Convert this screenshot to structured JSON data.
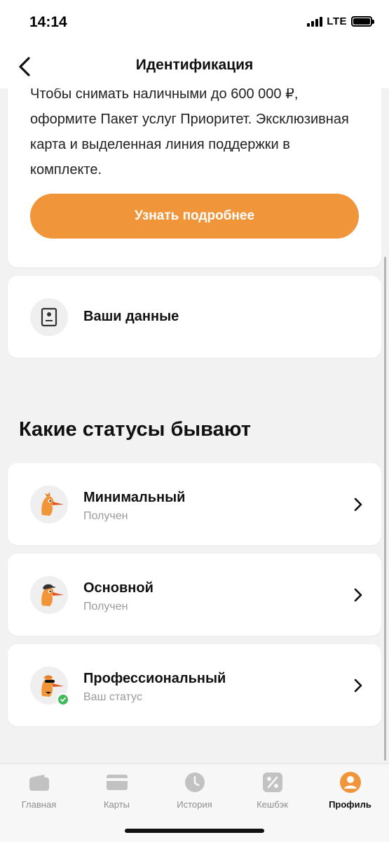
{
  "status_bar": {
    "time": "14:14",
    "network": "LTE"
  },
  "header": {
    "title": "Идентификация"
  },
  "promo": {
    "text": "Чтобы снимать наличными до 600 000 ₽, оформите Пакет услуг Приоритет. Эксклюзивная карта и выделенная линия поддержки в комплекте.",
    "button_label": "Узнать подробнее"
  },
  "your_data": {
    "label": "Ваши данные"
  },
  "statuses": {
    "title": "Какие статусы бывают",
    "items": [
      {
        "title": "Минимальный",
        "subtitle": "Получен"
      },
      {
        "title": "Основной",
        "subtitle": "Получен"
      },
      {
        "title": "Профессиональный",
        "subtitle": "Ваш статус"
      }
    ]
  },
  "tabs": [
    {
      "label": "Главная",
      "icon": "wallet-icon",
      "active": false
    },
    {
      "label": "Карты",
      "icon": "card-icon",
      "active": false
    },
    {
      "label": "История",
      "icon": "clock-icon",
      "active": false
    },
    {
      "label": "Кешбэк",
      "icon": "percent-icon",
      "active": false
    },
    {
      "label": "Профиль",
      "icon": "profile-icon",
      "active": true
    }
  ],
  "colors": {
    "accent": "#f0953a",
    "success": "#3fba5a",
    "inactive": "#c2c2c2"
  }
}
